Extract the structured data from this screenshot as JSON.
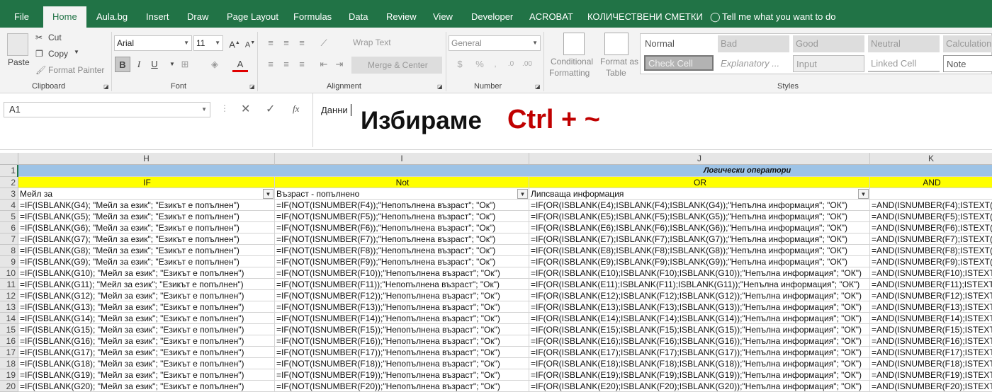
{
  "tabs": [
    "File",
    "Home",
    "Aula.bg",
    "Insert",
    "Draw",
    "Page Layout",
    "Formulas",
    "Data",
    "Review",
    "View",
    "Developer",
    "ACROBAT",
    "КОЛИЧЕСТВЕНИ СМЕТКИ"
  ],
  "tell_me": "Tell me what you want to do",
  "clipboard": {
    "paste": "Paste",
    "cut": "Cut",
    "copy": "Copy",
    "format_painter": "Format Painter",
    "group": "Clipboard"
  },
  "font": {
    "name": "Arial",
    "size": "11",
    "group": "Font",
    "bold": "B",
    "italic": "I",
    "underline": "U"
  },
  "alignment": {
    "wrap": "Wrap Text",
    "merge": "Merge & Center",
    "group": "Alignment"
  },
  "number": {
    "format": "General",
    "group": "Number",
    "percent": "%"
  },
  "styles": {
    "conditional": [
      "Conditional",
      "Formatting"
    ],
    "format_table": [
      "Format as",
      "Table"
    ],
    "group": "Styles",
    "cells": [
      "Normal",
      "Bad",
      "Good",
      "Neutral",
      "Calculation",
      "Check Cell",
      "Explanatory ...",
      "Input",
      "Linked Cell",
      "Note"
    ]
  },
  "formula_bar": {
    "name_box": "A1",
    "fx": "fx",
    "content": "Данни",
    "overlay": "Избираме ",
    "overlay_ctrl": "Ctrl + ~"
  },
  "columns": [
    "H",
    "I",
    "J",
    "K"
  ],
  "rows": {
    "numbers": [
      "1",
      "2",
      "3",
      "4",
      "5",
      "6",
      "7",
      "8",
      "9",
      "10",
      "11",
      "12",
      "13",
      "14",
      "15",
      "16",
      "17",
      "18",
      "19",
      "20"
    ],
    "r1": "Логически оператори",
    "r2": [
      "IF",
      "Not",
      "OR",
      "AND"
    ],
    "r3": [
      "Мейл за",
      "Възраст - попълнено",
      "Липсваща информация",
      ""
    ],
    "data": [
      [
        "=IF(ISBLANK(G4); \"Мейл за език\"; \"Езикът е попълнен\")",
        "=IF(NOT(ISNUMBER(F4));\"Непопълнена възраст\"; \"Ок\")",
        "=IF(OR(ISBLANK(E4);ISBLANK(F4);ISBLANK(G4));\"Непълна информация\"; \"ОК\")",
        "=AND(ISNUMBER(F4);ISTEXT(G"
      ],
      [
        "=IF(ISBLANK(G5); \"Мейл за език\"; \"Езикът е попълнен\")",
        "=IF(NOT(ISNUMBER(F5));\"Непопълнена възраст\"; \"Ок\")",
        "=IF(OR(ISBLANK(E5);ISBLANK(F5);ISBLANK(G5));\"Непълна информация\"; \"ОК\")",
        "=AND(ISNUMBER(F5);ISTEXT(G"
      ],
      [
        "=IF(ISBLANK(G6); \"Мейл за език\"; \"Езикът е попълнен\")",
        "=IF(NOT(ISNUMBER(F6));\"Непопълнена възраст\"; \"Ок\")",
        "=IF(OR(ISBLANK(E6);ISBLANK(F6);ISBLANK(G6));\"Непълна информация\"; \"ОК\")",
        "=AND(ISNUMBER(F6);ISTEXT(G"
      ],
      [
        "=IF(ISBLANK(G7); \"Мейл за език\"; \"Езикът е попълнен\")",
        "=IF(NOT(ISNUMBER(F7));\"Непопълнена възраст\"; \"Ок\")",
        "=IF(OR(ISBLANK(E7);ISBLANK(F7);ISBLANK(G7));\"Непълна информация\"; \"ОК\")",
        "=AND(ISNUMBER(F7);ISTEXT(G"
      ],
      [
        "=IF(ISBLANK(G8); \"Мейл за език\"; \"Езикът е попълнен\")",
        "=IF(NOT(ISNUMBER(F8));\"Непопълнена възраст\"; \"Ок\")",
        "=IF(OR(ISBLANK(E8);ISBLANK(F8);ISBLANK(G8));\"Непълна информация\"; \"ОК\")",
        "=AND(ISNUMBER(F8);ISTEXT(G"
      ],
      [
        "=IF(ISBLANK(G9); \"Мейл за език\"; \"Езикът е попълнен\")",
        "=IF(NOT(ISNUMBER(F9));\"Непопълнена възраст\"; \"Ок\")",
        "=IF(OR(ISBLANK(E9);ISBLANK(F9);ISBLANK(G9));\"Непълна информация\"; \"ОК\")",
        "=AND(ISNUMBER(F9);ISTEXT(G"
      ],
      [
        "=IF(ISBLANK(G10); \"Мейл за език\"; \"Езикът е попълнен\")",
        "=IF(NOT(ISNUMBER(F10));\"Непопълнена възраст\"; \"Ок\")",
        "=IF(OR(ISBLANK(E10);ISBLANK(F10);ISBLANK(G10));\"Непълна информация\"; \"ОК\")",
        "=AND(ISNUMBER(F10);ISTEXT"
      ],
      [
        "=IF(ISBLANK(G11); \"Мейл за език\"; \"Езикът е попълнен\")",
        "=IF(NOT(ISNUMBER(F11));\"Непопълнена възраст\"; \"Ок\")",
        "=IF(OR(ISBLANK(E11);ISBLANK(F11);ISBLANK(G11));\"Непълна информация\"; \"ОК\")",
        "=AND(ISNUMBER(F11);ISTEXT"
      ],
      [
        "=IF(ISBLANK(G12); \"Мейл за език\"; \"Езикът е попълнен\")",
        "=IF(NOT(ISNUMBER(F12));\"Непопълнена възраст\"; \"Ок\")",
        "=IF(OR(ISBLANK(E12);ISBLANK(F12);ISBLANK(G12));\"Непълна информация\"; \"ОК\")",
        "=AND(ISNUMBER(F12);ISTEXT"
      ],
      [
        "=IF(ISBLANK(G13); \"Мейл за език\"; \"Езикът е попълнен\")",
        "=IF(NOT(ISNUMBER(F13));\"Непопълнена възраст\"; \"Ок\")",
        "=IF(OR(ISBLANK(E13);ISBLANK(F13);ISBLANK(G13));\"Непълна информация\"; \"ОК\")",
        "=AND(ISNUMBER(F13);ISTEXT"
      ],
      [
        "=IF(ISBLANK(G14); \"Мейл за език\"; \"Езикът е попълнен\")",
        "=IF(NOT(ISNUMBER(F14));\"Непопълнена възраст\"; \"Ок\")",
        "=IF(OR(ISBLANK(E14);ISBLANK(F14);ISBLANK(G14));\"Непълна информация\"; \"ОК\")",
        "=AND(ISNUMBER(F14);ISTEXT"
      ],
      [
        "=IF(ISBLANK(G15); \"Мейл за език\"; \"Езикът е попълнен\")",
        "=IF(NOT(ISNUMBER(F15));\"Непопълнена възраст\"; \"Ок\")",
        "=IF(OR(ISBLANK(E15);ISBLANK(F15);ISBLANK(G15));\"Непълна информация\"; \"ОК\")",
        "=AND(ISNUMBER(F15);ISTEXT"
      ],
      [
        "=IF(ISBLANK(G16); \"Мейл за език\"; \"Езикът е попълнен\")",
        "=IF(NOT(ISNUMBER(F16));\"Непопълнена възраст\"; \"Ок\")",
        "=IF(OR(ISBLANK(E16);ISBLANK(F16);ISBLANK(G16));\"Непълна информация\"; \"ОК\")",
        "=AND(ISNUMBER(F16);ISTEXT"
      ],
      [
        "=IF(ISBLANK(G17); \"Мейл за език\"; \"Езикът е попълнен\")",
        "=IF(NOT(ISNUMBER(F17));\"Непопълнена възраст\"; \"Ок\")",
        "=IF(OR(ISBLANK(E17);ISBLANK(F17);ISBLANK(G17));\"Непълна информация\"; \"ОК\")",
        "=AND(ISNUMBER(F17);ISTEXT"
      ],
      [
        "=IF(ISBLANK(G18); \"Мейл за език\"; \"Езикът е попълнен\")",
        "=IF(NOT(ISNUMBER(F18));\"Непопълнена възраст\"; \"Ок\")",
        "=IF(OR(ISBLANK(E18);ISBLANK(F18);ISBLANK(G18));\"Непълна информация\"; \"ОК\")",
        "=AND(ISNUMBER(F18);ISTEXT"
      ],
      [
        "=IF(ISBLANK(G19); \"Мейл за език\"; \"Езикът е попълнен\")",
        "=IF(NOT(ISNUMBER(F19));\"Непопълнена възраст\"; \"Ок\")",
        "=IF(OR(ISBLANK(E19);ISBLANK(F19);ISBLANK(G19));\"Непълна информация\"; \"ОК\")",
        "=AND(ISNUMBER(F19);ISTEXT"
      ],
      [
        "=IF(ISBLANK(G20); \"Мейл за език\"; \"Езикът е попълнен\")",
        "=IF(NOT(ISNUMBER(F20));\"Непопълнена възраст\"; \"Ок\")",
        "=IF(OR(ISBLANK(E20);ISBLANK(F20);ISBLANK(G20));\"Непълна информация\"; \"ОК\")",
        "=AND(ISNUMBER(F20);ISTEXT"
      ]
    ]
  },
  "colors": {
    "brand": "#217346",
    "header_blue": "#9dc3e6",
    "header_yellow": "#ffff00",
    "overlay_red": "#c00000"
  }
}
